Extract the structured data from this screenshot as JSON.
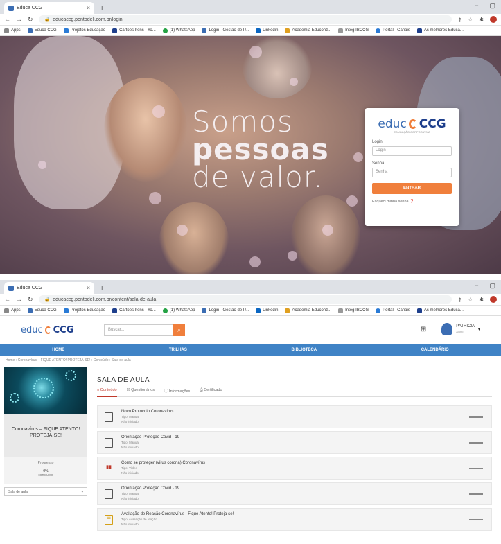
{
  "screen1": {
    "tab_title": "Educa CCG",
    "url": "educaccg.pontodeli.com.br/login",
    "bookmarks": [
      "Apps",
      "Educa CCG",
      "Projetos Educação",
      "Cartões Itens - Yo...",
      "(1) WhatsApp",
      "Login - Gestão de P...",
      "Linkedin",
      "Academia Educonz...",
      "Integ IBCCG",
      "Portal - Canais",
      "As melhores Educa..."
    ],
    "tagline": {
      "line1": "Somos",
      "line2": "pessoas",
      "line3": "de valor."
    },
    "login": {
      "logo_educ": "educ",
      "logo_ccg": "CCG",
      "logo_sub": "EDUCAÇÃO CORPORATIVA",
      "login_label": "Login",
      "login_placeholder": "Login",
      "password_label": "Senha",
      "password_placeholder": "Senha",
      "submit": "ENTRAR",
      "forgot": "Esqueci minha senha"
    }
  },
  "screen2": {
    "tab_title": "Educa CCG",
    "url": "educaccg.pontodeli.com.br/content/sala-de-aula",
    "bookmarks": [
      "Apps",
      "Educa CCG",
      "Projetos Educação",
      "Cartões Itens - Yo...",
      "(1) WhatsApp",
      "Login - Gestão de P...",
      "Linkedin",
      "Academia Educonz...",
      "Integ IBCCG",
      "Portal - Canais",
      "As melhores Educa..."
    ],
    "header": {
      "logo_educ": "educ",
      "logo_ccg": "CCG",
      "search_placeholder": "Buscar...",
      "search_button": "⌕",
      "apps_icon": "⊞",
      "user_name": "PATRICIA",
      "user_role": "Aluno"
    },
    "nav": [
      "HOME",
      "TRILHAS",
      "BIBLIOTECA",
      "CALENDÁRIO"
    ],
    "breadcrumb": "Home › Coronavírus – FIQUE ATENTO! PROTEJA-SE! › Conteúdo › Sala de aula",
    "course": {
      "title": "Coronavírus – FIQUE ATENTO! PROTEJA-SE!",
      "progress_label": "Progresso",
      "progress_value": "0%",
      "progress_sub": "concluído",
      "select_label": "Sala de aula"
    },
    "main": {
      "title": "SALA DE AULA",
      "tabs": [
        "Conteúdo",
        "Questionários",
        "Informações",
        "Certificado"
      ],
      "items": [
        {
          "title": "Novo Protocolo Coronavírus",
          "sub": "Tipo: Manual",
          "stat": "Não iniciado",
          "icon": "doc"
        },
        {
          "title": "Orientação Proteção Covid - 19",
          "sub": "Tipo: Manual",
          "stat": "Não iniciado",
          "icon": "doc"
        },
        {
          "title": "Como se proteger (vírus corona) Coronavírus",
          "sub": "Tipo: Vídeo",
          "stat": "Não iniciado",
          "icon": "video"
        },
        {
          "title": "Orientação Proteção Covid - 19",
          "sub": "Tipo: Manual",
          "stat": "Não iniciado",
          "icon": "doc"
        },
        {
          "title": "Avaliação de Reação Coronavírus - Fique Atento! Proteja-se!",
          "sub": "Tipo: Avaliação de reação",
          "stat": "Não iniciado",
          "icon": "eval"
        }
      ]
    }
  }
}
